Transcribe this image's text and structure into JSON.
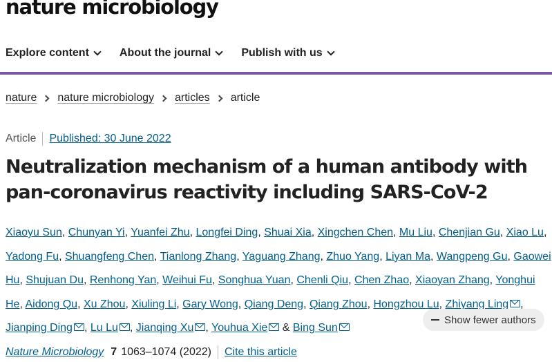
{
  "site": {
    "logo": "nature microbiology"
  },
  "nav": [
    {
      "label": "Explore content"
    },
    {
      "label": "About the journal"
    },
    {
      "label": "Publish with us"
    }
  ],
  "breadcrumb": [
    {
      "label": "nature"
    },
    {
      "label": "nature microbiology"
    },
    {
      "label": "articles"
    },
    {
      "label": "article"
    }
  ],
  "article": {
    "type": "Article",
    "published": "Published: 30 June 2022",
    "title": "Neutralization mechanism of a human antibody with pan-coronavirus reactivity including SARS-CoV-2",
    "authors": [
      "Xiaoyu Sun",
      "Chunyan Yi",
      "Yuanfei Zhu",
      "Longfei Ding",
      "Shuai Xia",
      "Xingchen Chen",
      "Mu Liu",
      "Chenjian Gu",
      "Xiao Lu",
      "Yadong Fu",
      "Shuangfeng Chen",
      "Tianlong Zhang",
      "Yaguang Zhang",
      "Zhuo Yang",
      "Liyan Ma",
      "Wangpeng Gu",
      "Gaowei Hu",
      "Shujuan Du",
      "Renhong Yan",
      "Weihui Fu",
      "Songhua Yuan",
      "Chenli Qiu",
      "Chen Zhao",
      "Xiaoyan Zhang",
      "Yonghui He",
      "Aidong Qu",
      "Xu Zhou",
      "Xiuling Li",
      "Gary Wong",
      "Qiang Deng",
      "Qiang Zhou",
      "Hongzhou Lu",
      "Zhiyang Ling",
      "Jianping Ding",
      "Lu Lu",
      "Jianqing Xu",
      "Youhua Xie",
      "Bing Sun"
    ],
    "authors_joiner": "&",
    "show_fewer_label": "Show fewer authors",
    "journal": "Nature Microbiology",
    "volume": "7",
    "pages": "1063–1074 (2022)",
    "cite_label": "Cite this article"
  },
  "colors": {
    "link": "#025e8d",
    "accent_rule": "#78569d",
    "pill_bg": "#eeeeee"
  },
  "icons": {
    "nav_chevron": "chevron-down-icon",
    "crumb_sep": "chevron-right-icon",
    "mail": "mail-icon",
    "minus": "minus-icon"
  }
}
